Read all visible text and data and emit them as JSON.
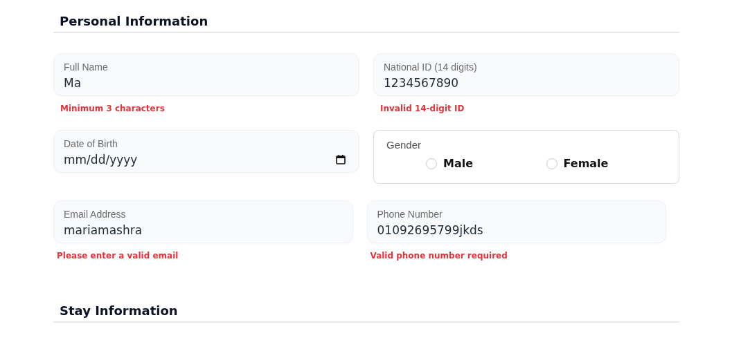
{
  "sections": [
    {
      "title": "Personal Information",
      "rows": [
        {
          "kind": "wide",
          "fields": [
            {
              "kind": "text",
              "label": "Full Name",
              "value": "Ma",
              "error": "Minimum 3 characters"
            },
            {
              "kind": "text",
              "label": "National ID (14 digits)",
              "value": "1234567890",
              "error": "Invalid 14-digit ID"
            }
          ]
        },
        {
          "kind": "wide",
          "fields": [
            {
              "kind": "date",
              "label": "Date of Birth",
              "value": "mm/dd/yyyy"
            },
            {
              "kind": "radio",
              "label": "Gender",
              "options": [
                {
                  "label": "Male",
                  "selected": false
                },
                {
                  "label": "Female",
                  "selected": false
                }
              ]
            }
          ]
        },
        {
          "kind": "narrow",
          "fields": [
            {
              "kind": "text",
              "label": "Email Address",
              "value": "mariamashra",
              "error": "Please enter a valid email"
            },
            {
              "kind": "text",
              "label": "Phone Number",
              "value": "01092695799jkds",
              "error": "Valid phone number required"
            }
          ]
        }
      ]
    },
    {
      "title": "Stay Information"
    }
  ]
}
